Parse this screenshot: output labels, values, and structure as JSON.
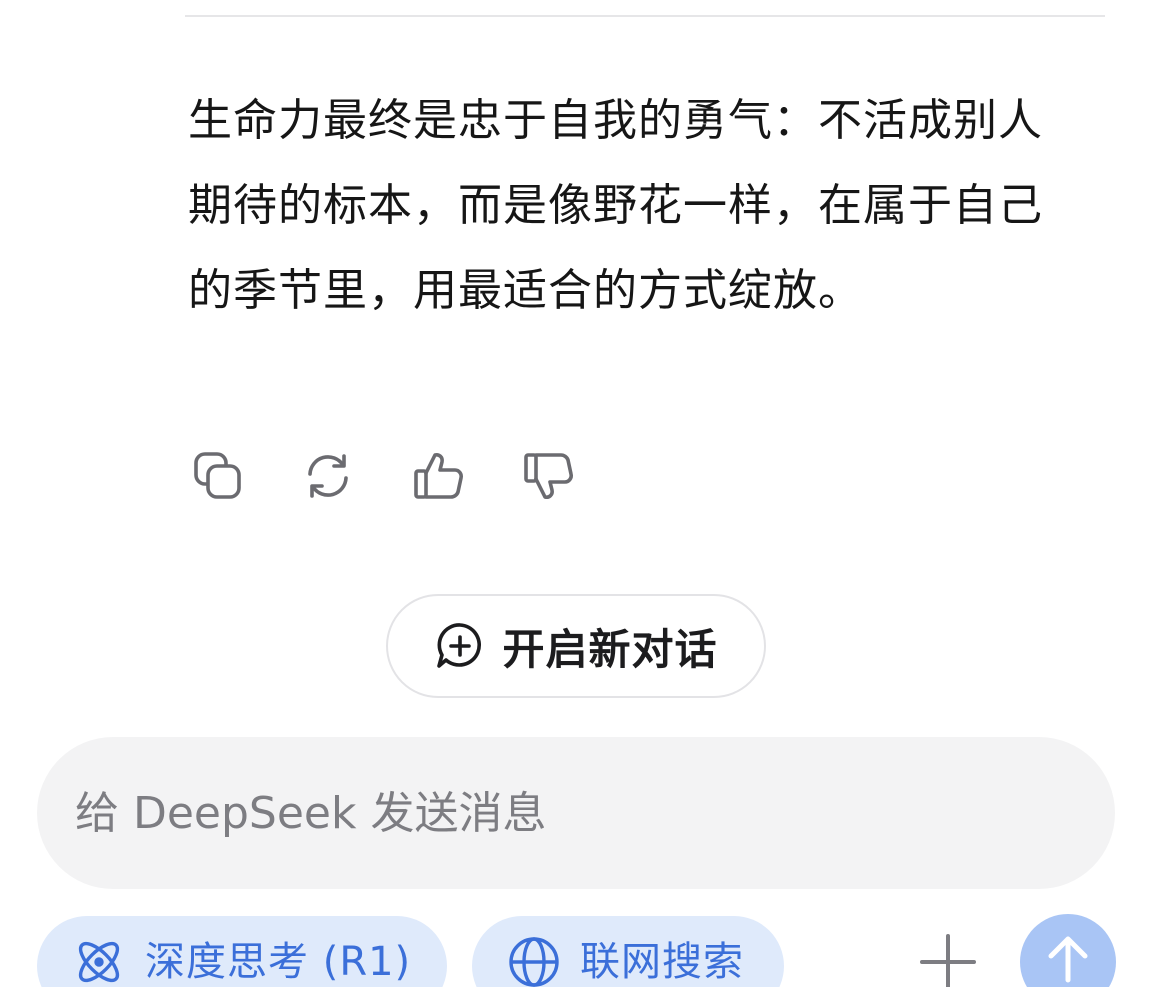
{
  "message": {
    "text": "生命力最终是忠于自我的勇气：不活成别人期待的标本，而是像野花一样，在属于自己的季节里，用最适合的方式绽放。"
  },
  "message_actions": [
    {
      "name": "copy-icon"
    },
    {
      "name": "regenerate-icon"
    },
    {
      "name": "thumbs-up-icon"
    },
    {
      "name": "thumbs-down-icon"
    }
  ],
  "new_chat": {
    "icon": "chat-plus-icon",
    "label": "开启新对话"
  },
  "composer": {
    "placeholder": "给 DeepSeek 发送消息"
  },
  "toolbar": {
    "deep_think": {
      "icon": "atom-icon",
      "label": "深度思考 (R1)"
    },
    "web_search": {
      "icon": "globe-icon",
      "label": "联网搜索"
    },
    "add_icon": "plus-icon",
    "send_icon": "arrow-up-icon"
  },
  "colors": {
    "chip_bg": "#dfeafb",
    "chip_text": "#3b6fd9",
    "send_bg": "#a9c5f5",
    "composer_bg": "#f3f3f4"
  }
}
